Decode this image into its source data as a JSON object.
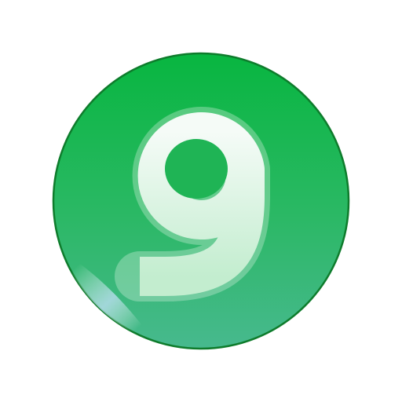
{
  "icon": {
    "name": "number-nine-badge-icon",
    "digit": "9",
    "colors": {
      "circle_top": "#08b640",
      "circle_bottom": "#47b98e",
      "circle_edge": "#0e7c2c",
      "sheen": "#bfe0f4",
      "digit_top": "#f5fbf7",
      "digit_bottom": "#c3edcf"
    }
  }
}
